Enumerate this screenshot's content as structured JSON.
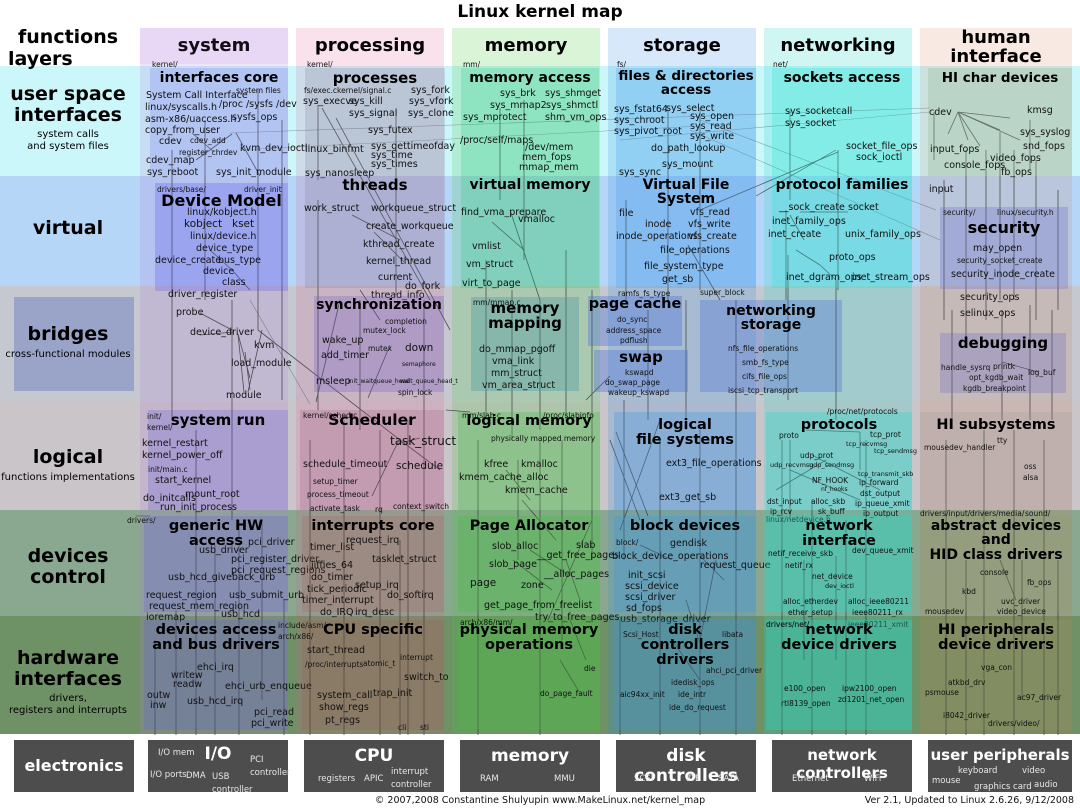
{
  "title": "Linux kernel map",
  "header": {
    "functions_label": "functions",
    "layers_label": "layers"
  },
  "footer": {
    "copyright": "© 2007,2008 Constantine Shulyupin www.MakeLinux.net/kernel_map",
    "version": "Ver 2.1, Updated to Linux 2.6.26, 9/12/2008"
  },
  "colors": {
    "system": "#d9c6ee",
    "processing": "#f2cada",
    "memory": "#c6f0bf",
    "storage": "#b6d9f5",
    "networking": "#c4f5f0",
    "human_interface": "#f3ddd4",
    "layer_user": "#cbf7fb",
    "layer_virtual": "#b6d6f7",
    "layer_bridges": "#c5c8cf",
    "layer_logical": "#c9c5c9",
    "layer_devices": "#8aa890",
    "layer_hardware": "#6f9166",
    "electronics": "#4d4d4d"
  },
  "columns": [
    {
      "name": "system",
      "label": "system"
    },
    {
      "name": "processing",
      "label": "processing"
    },
    {
      "name": "memory",
      "label": "memory"
    },
    {
      "name": "storage",
      "label": "storage"
    },
    {
      "name": "networking",
      "label": "networking"
    },
    {
      "name": "human_interface",
      "label": "human\ninterface"
    }
  ],
  "layers": [
    {
      "name": "user_space_interfaces",
      "title": "user space\ninterfaces",
      "sub": "system calls\nand system files"
    },
    {
      "name": "virtual",
      "title": "virtual",
      "sub": ""
    },
    {
      "name": "bridges",
      "title": "bridges",
      "sub": "cross-functional modules"
    },
    {
      "name": "logical",
      "title": "logical",
      "sub": "functions implementations"
    },
    {
      "name": "devices_control",
      "title": "devices\ncontrol",
      "sub": ""
    },
    {
      "name": "hardware_interfaces",
      "title": "hardware\ninterfaces",
      "sub": "drivers,\nregisters and interrupts"
    },
    {
      "name": "electronics",
      "title": "electronics",
      "sub": ""
    }
  ],
  "boxes": [
    {
      "id": "interfaces-core",
      "title": "interfaces core",
      "path": "kernel/",
      "funcs": [
        "System Call Interface",
        "system files",
        "linux/syscalls.h",
        "/proc  /sysfs  /dev",
        "asm-x86/uaccess.h",
        "sysfs_ops",
        "copy_from_user",
        "cdev",
        "cdev_add",
        "register_chrdev",
        "kvm_dev_ioctl",
        "cdev_map",
        "sys_reboot",
        "sys_init_module"
      ]
    },
    {
      "id": "processes",
      "title": "processes",
      "path": "kernel/",
      "funcs": [
        "fs/exec.c",
        "kernel/signal.c",
        "sys_fork",
        "sys_execve",
        "sys_kill",
        "sys_vfork",
        "sys_signal",
        "sys_clone",
        "sys_futex",
        "linux_binfmt",
        "sys_gettimeofday",
        "sys_time",
        "sys_times",
        "sys_nanosleep"
      ]
    },
    {
      "id": "memory-access",
      "title": "memory access",
      "path": "mm/",
      "funcs": [
        "sys_brk",
        "sys_shmget",
        "sys_mmap2",
        "sys_shmctl",
        "sys_mprotect",
        "shm_vm_ops",
        "/proc/self/maps",
        "/dev/mem",
        "mem_fops",
        "mmap_mem"
      ]
    },
    {
      "id": "files-directories-access",
      "title": "files & directories\naccess",
      "path": "fs/",
      "funcs": [
        "sys_fstat64",
        "sys_select",
        "sys_open",
        "sys_chroot",
        "sys_read",
        "sys_pivot_root",
        "sys_write",
        "do_path_lookup",
        "sys_mount",
        "sys_sync"
      ]
    },
    {
      "id": "sockets-access",
      "title": "sockets access",
      "path": "net/",
      "funcs": [
        "sys_socketcall",
        "sys_socket",
        "socket_file_ops",
        "sock_ioctl"
      ]
    },
    {
      "id": "hi-char-devices",
      "title": "HI char devices",
      "path": "",
      "funcs": [
        "cdev",
        "kmsg",
        "sys_syslog",
        "input_fops",
        "snd_fops",
        "console_fops",
        "video_fops",
        "fb_ops",
        "input"
      ]
    },
    {
      "id": "device-model",
      "title": "Device Model",
      "path": "drivers/base/",
      "funcs": [
        "driver_init",
        "linux/kobject.h",
        "kobject",
        "kset",
        "linux/device.h",
        "device_type",
        "device_create",
        "bus_type",
        "device",
        "class",
        "driver_register",
        "probe",
        "device_driver",
        "kvm",
        "load_module",
        "module"
      ]
    },
    {
      "id": "threads",
      "title": "threads",
      "path": "",
      "funcs": [
        "work_struct",
        "workqueue_struct",
        "create_workqueue",
        "kthread_create",
        "kernel_thread",
        "current",
        "do_fork",
        "thread_info"
      ]
    },
    {
      "id": "virtual-memory",
      "title": "virtual memory",
      "path": "",
      "funcs": [
        "find_vma_prepare",
        "vmalloc",
        "vmlist",
        "vm_struct",
        "virt_to_page"
      ]
    },
    {
      "id": "virtual-file-system",
      "title": "Virtual File System",
      "path": "",
      "funcs": [
        "file",
        "vfs_read",
        "inode",
        "vfs_write",
        "inode_operations",
        "vfs_create",
        "file_operations",
        "file_system_type",
        "get_sb",
        "ramfs_fs_type",
        "super_block"
      ]
    },
    {
      "id": "protocol-families",
      "title": "protocol families",
      "path": "",
      "funcs": [
        "__sock_create",
        "socket",
        "inet_family_ops",
        "inet_create",
        "unix_family_ops",
        "proto_ops",
        "inet_dgram_ops",
        "inet_stream_ops"
      ]
    },
    {
      "id": "security",
      "title": "security",
      "path": "security/",
      "funcs": [
        "linux/security.h",
        "may_open",
        "security_socket_create",
        "security_inode_create",
        "security_ops",
        "selinux_ops"
      ]
    },
    {
      "id": "synchronization",
      "title": "synchronization",
      "path": "",
      "funcs": [
        "completion",
        "mutex_lock",
        "wake_up",
        "mutex",
        "down",
        "add_timer",
        "semaphore",
        "msleep",
        "init_waitqueue_head",
        "wait_queue_head_t",
        "spin_lock"
      ]
    },
    {
      "id": "memory-mapping",
      "title": "memory\nmapping",
      "path": "mm/mmap.c",
      "funcs": [
        "do_mmap_pgoff",
        "vma_link",
        "mm_struct",
        "vm_area_struct"
      ]
    },
    {
      "id": "page-cache",
      "title": "page cache",
      "path": "",
      "funcs": [
        "do_sync",
        "address_space",
        "pdflush"
      ]
    },
    {
      "id": "swap",
      "title": "swap",
      "path": "",
      "funcs": [
        "kswapd",
        "do_swap_page",
        "wakeup_kswapd"
      ]
    },
    {
      "id": "networking-storage",
      "title": "networking\nstorage",
      "path": "",
      "funcs": [
        "nfs_file_operations",
        "smb_fs_type",
        "cifs_file_ops",
        "iscsi_tcp_transport"
      ]
    },
    {
      "id": "debugging",
      "title": "debugging",
      "path": "",
      "funcs": [
        "handle_sysrq",
        "printk",
        "log_buf",
        "opt_kgdb_wait",
        "kgdb_breakpoint"
      ]
    },
    {
      "id": "system-run",
      "title": "system run",
      "path": "init/\nkernel/",
      "funcs": [
        "kernel_restart",
        "kernel_power_off",
        "init/main.c",
        "start_kernel",
        "do_initcalls",
        "mount_root",
        "run_init_process"
      ]
    },
    {
      "id": "scheduler",
      "title": "Scheduler",
      "path": "kernel/sched.c",
      "funcs": [
        "task_struct",
        "schedule_timeout",
        "schedule",
        "setup_timer",
        "process_timeout",
        "context_switch",
        "activate_task",
        "rq"
      ]
    },
    {
      "id": "logical-memory",
      "title": "logical memory",
      "path": "mm/slab.c",
      "funcs": [
        "/proc/slabinfo",
        "physically mapped memory",
        "kfree",
        "kmalloc",
        "kmem_cache_alloc",
        "kmem_cache"
      ]
    },
    {
      "id": "logical-file-systems",
      "title": "logical\nfile systems",
      "path": "",
      "funcs": [
        "ext3_file_operations",
        "ext3_get_sb"
      ]
    },
    {
      "id": "protocols",
      "title": "protocols",
      "path": "/proc/net/protocols",
      "funcs": [
        "proto",
        "tcp_prot",
        "tcp_recvmsg",
        "tcp_sendmsg",
        "udp_prot",
        "udp_recvmsg",
        "udp_sendmsg",
        "tcp_transmit_skb",
        "NF_HOOK",
        "nf_hooks",
        "ip_forward",
        "dst_output",
        "dst_input",
        "alloc_skb",
        "ip_queue_xmit",
        "ip_rcv",
        "sk_buff",
        "ip_output",
        "linux/netdevice.h"
      ]
    },
    {
      "id": "hi-subsystems",
      "title": "HI subsystems",
      "path": "",
      "funcs": [
        "tty",
        "mousedev_handler",
        "oss",
        "alsa",
        "drivers/input/",
        "drivers/media/",
        "sound/"
      ]
    },
    {
      "id": "generic-hw-access",
      "title": "generic HW access",
      "path": "drivers/",
      "funcs": [
        "pci_driver",
        "usb_driver",
        "pci_register_driver",
        "pci_request_regions",
        "usb_hcd_giveback_urb",
        "request_region",
        "usb_submit_urb",
        "request_mem_region",
        "ioremap",
        "usb_hcd"
      ]
    },
    {
      "id": "interrupts-core",
      "title": "interrupts core",
      "path": "",
      "funcs": [
        "request_irq",
        "timer_list",
        "tasklet_struct",
        "jiffies_64",
        "do_timer",
        "tick_periodic",
        "setup_irq",
        "timer_interrupt",
        "do_softirq",
        "do_IRQ",
        "irq_desc"
      ]
    },
    {
      "id": "page-allocator",
      "title": "Page Allocator",
      "path": "",
      "funcs": [
        "slab",
        "slob_alloc",
        "__get_free_pages",
        "slob_page",
        "__alloc_pages",
        "page",
        "zone",
        "get_page_from_freelist",
        "try_to_free_pages"
      ]
    },
    {
      "id": "block-devices",
      "title": "block devices",
      "path": "block/",
      "funcs": [
        "gendisk",
        "block_device_operations",
        "request_queue",
        "init_scsi",
        "scsi_device",
        "scsi_driver",
        "sd_fops",
        "usb_storage_driver"
      ]
    },
    {
      "id": "network-interface",
      "title": "network interface",
      "path": "",
      "funcs": [
        "netif_receive_skb",
        "dev_queue_xmit",
        "netif_rx",
        "net_device",
        "dev_ioctl",
        "alloc_etherdev",
        "alloc_ieee80211",
        "ether_setup",
        "ieee80211_rx",
        "ieee80211_xmit",
        "drivers/net/"
      ]
    },
    {
      "id": "abstract-devices",
      "title": "abstract devices\nand\nHID class drivers",
      "path": "",
      "funcs": [
        "console",
        "fb_ops",
        "kbd",
        "uvc_driver",
        "mousedev",
        "video_device"
      ]
    },
    {
      "id": "devices-access",
      "title": "devices access\nand bus drivers",
      "path": "",
      "funcs": [
        "ehci_irq",
        "writew",
        "readw",
        "ehci_urb_enqueue",
        "outw",
        "inw",
        "usb_hcd_irq",
        "pci_read",
        "pci_write"
      ]
    },
    {
      "id": "cpu-specific",
      "title": "CPU specific",
      "path": "include/asm/\narch/x86/",
      "funcs": [
        "start_thread",
        "interrupt",
        "/proc/interrupts",
        "atomic_t",
        "switch_to",
        "system_call",
        "trap_init",
        "show_regs",
        "pt_regs",
        "cli",
        "sti"
      ]
    },
    {
      "id": "physical-memory-operations",
      "title": "physical memory\noperations",
      "path": "arch/x86/mm/",
      "funcs": [
        "die",
        "do_page_fault"
      ]
    },
    {
      "id": "disk-controllers-drivers",
      "title": "disk\ncontrollers drivers",
      "path": "",
      "funcs": [
        "Scsi_Host",
        "libata",
        "ahci_pci_driver",
        "idedisk_ops",
        "aic94xx_init",
        "ide_intr",
        "ide_do_request"
      ]
    },
    {
      "id": "network-device-drivers",
      "title": "network\ndevice drivers",
      "path": "drivers/net/",
      "funcs": [
        "e100_open",
        "ipw2100_open",
        "zd1201_net_open",
        "rtl8139_open"
      ]
    },
    {
      "id": "hi-peripherals-device-drivers",
      "title": "HI peripherals\ndevice drivers",
      "path": "",
      "funcs": [
        "vga_con",
        "atkbd_drv",
        "psmouse",
        "ac97_driver",
        "i8042_driver",
        "drivers/video/"
      ]
    }
  ],
  "electronics": [
    {
      "id": "io",
      "title": "I/O",
      "funcs": [
        "I/O mem",
        "I/O ports",
        "DMA",
        "USB\ncontroller",
        "PCI\ncontroller"
      ]
    },
    {
      "id": "cpu",
      "title": "CPU",
      "funcs": [
        "registers",
        "APIC",
        "interrupt\ncontroller"
      ]
    },
    {
      "id": "memory",
      "title": "memory",
      "funcs": [
        "RAM",
        "MMU"
      ]
    },
    {
      "id": "disk-controllers",
      "title": "disk controllers",
      "funcs": [
        "SCSI",
        "IDE",
        "SATA"
      ]
    },
    {
      "id": "network-controllers",
      "title": "network controllers",
      "funcs": [
        "Ethernet",
        "WiFi"
      ]
    },
    {
      "id": "user-peripherals",
      "title": "user peripherals",
      "funcs": [
        "keyboard",
        "video",
        "mouse",
        "audio",
        "graphics card"
      ]
    }
  ]
}
